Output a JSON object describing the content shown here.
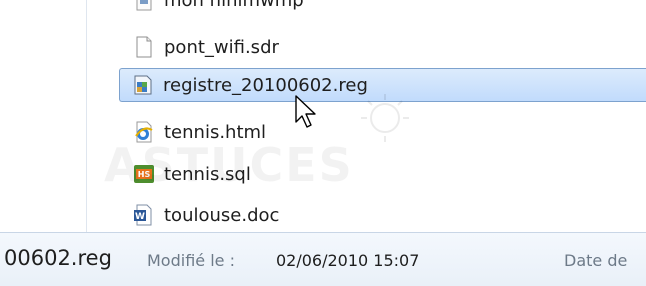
{
  "files": [
    {
      "name": "mon hihimwmp",
      "icon": "media-file-icon"
    },
    {
      "name": "pont_wifi.sdr",
      "icon": "blank-file-icon"
    },
    {
      "name": "registre_20100602.reg",
      "icon": "registry-file-icon",
      "selected": true
    },
    {
      "name": "tennis.html",
      "icon": "ie-html-icon"
    },
    {
      "name": "tennis.sql",
      "icon": "hs-sql-icon"
    },
    {
      "name": "toulouse.doc",
      "icon": "word-doc-icon"
    }
  ],
  "watermark": {
    "text": "ASTUCES"
  },
  "statusbar": {
    "filename": "00602.reg",
    "modified_label": "Modifié le :",
    "modified_value": "02/06/2010 15:07",
    "date_label": "Date de"
  },
  "colors": {
    "selection_fill": "#c9e0fc",
    "selection_border": "#7da2ce",
    "status_bg": "#eef3f9",
    "status_label": "#6d7a88"
  }
}
